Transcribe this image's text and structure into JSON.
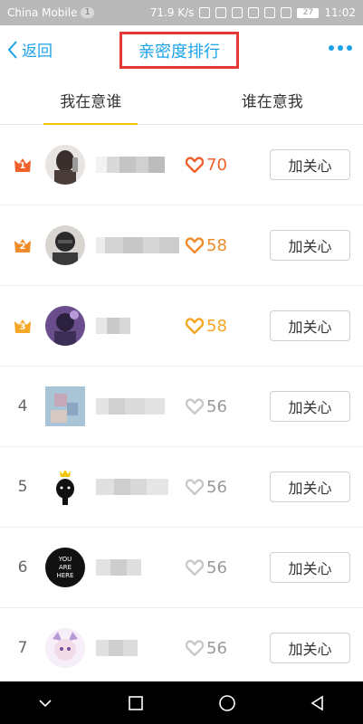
{
  "status_bar": {
    "carrier": "China Mobile",
    "sim_badge": "1",
    "speed": "71.9 K/s",
    "battery": "27",
    "time": "11:02"
  },
  "header": {
    "back_label": "返回",
    "title": "亲密度排行"
  },
  "tabs": [
    {
      "label": "我在意谁",
      "active": true
    },
    {
      "label": "谁在意我",
      "active": false
    }
  ],
  "ranking": [
    {
      "rank": "1",
      "score": "70",
      "heart_color": "#f0602a",
      "crown_color": "#f0602a",
      "button": "加关心"
    },
    {
      "rank": "2",
      "score": "58",
      "heart_color": "#f08b2a",
      "crown_color": "#f08b2a",
      "button": "加关心"
    },
    {
      "rank": "3",
      "score": "58",
      "heart_color": "#f5a623",
      "crown_color": "#f5a623",
      "button": "加关心"
    },
    {
      "rank": "4",
      "score": "56",
      "heart_color": "#c8c8c8",
      "button": "加关心"
    },
    {
      "rank": "5",
      "score": "56",
      "heart_color": "#c8c8c8",
      "button": "加关心"
    },
    {
      "rank": "6",
      "score": "56",
      "heart_color": "#c8c8c8",
      "button": "加关心"
    },
    {
      "rank": "7",
      "score": "56",
      "heart_color": "#c8c8c8",
      "button": "加关心"
    }
  ],
  "avatar_texts": {
    "row6": [
      "YOU",
      "ARE",
      "HERE"
    ]
  },
  "colors": {
    "accent": "#1aa3e8",
    "title_box": "#e53935",
    "tab_underline": "#f2c500"
  }
}
